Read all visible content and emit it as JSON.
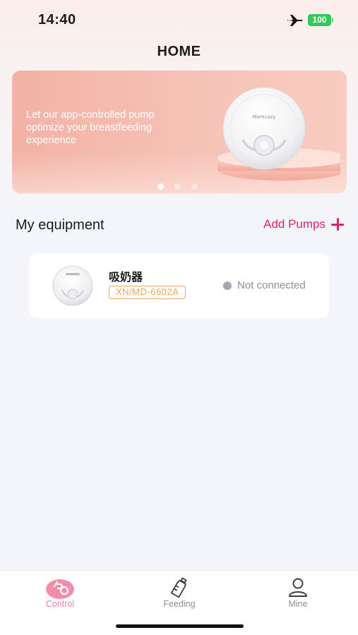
{
  "status_bar": {
    "time": "14:40",
    "battery": "100"
  },
  "header": {
    "title": "HOME"
  },
  "banner": {
    "text": "Let our app-controlled pump optimize your breastfeeding experience",
    "product_brand": "Momcozy",
    "active_slide": 1,
    "slide_count": 3
  },
  "equipment": {
    "section_title": "My equipment",
    "add_label": "Add Pumps",
    "devices": [
      {
        "name": "吸奶器",
        "model": "XN/MD-6602A",
        "status": "Not connected"
      }
    ]
  },
  "tabs": [
    {
      "label": "Control",
      "icon": "control-icon",
      "active": true
    },
    {
      "label": "Feeding",
      "icon": "bottle-icon",
      "active": false
    },
    {
      "label": "Mine",
      "icon": "user-icon",
      "active": false
    }
  ],
  "colors": {
    "accent": "#e0245e",
    "tab_active": "#ef7fa0",
    "model_tag": "#f4a55c",
    "battery": "#34c759",
    "banner": "#f4b8ab"
  }
}
